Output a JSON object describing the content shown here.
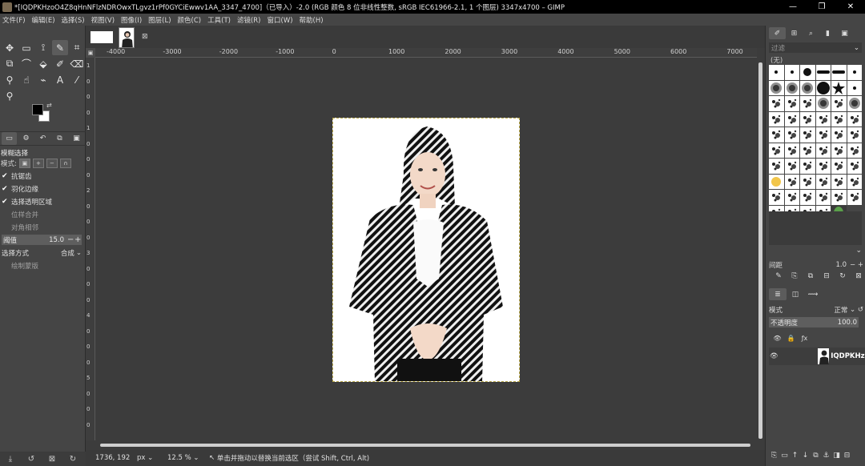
{
  "window": {
    "title": "*[IQDPKHzoO4Z8qHnNFlzNDROwxTLgvz1rPf0GYCiEwwv1AA_3347_4700]（已导入）-2.0 (RGB 颜色 8 位非线性整数, sRGB IEC61966-2.1, 1 个图层) 3347x4700 – GIMP",
    "min": "—",
    "max": "❐",
    "close": "✕"
  },
  "menu": [
    "文件(F)",
    "编辑(E)",
    "选择(S)",
    "视图(V)",
    "图像(I)",
    "图层(L)",
    "颜色(C)",
    "工具(T)",
    "滤镜(R)",
    "窗口(W)",
    "帮助(H)"
  ],
  "tool_options": {
    "title": "模糊选择",
    "mode_label": "模式:",
    "antialias": "抗锯齿",
    "feather": "羽化边缘",
    "select_transparent": "选择透明区域",
    "sample_merged": "位样合并",
    "diagonal": "对角相邻",
    "threshold_label": "阈值",
    "threshold_value": "15.0",
    "select_by_label": "选择方式",
    "select_by_value": "合成",
    "draw_mask": "绘制蒙版"
  },
  "ruler": {
    "h_ticks": [
      "-4000",
      "-3000",
      "-2000",
      "-1000",
      "0",
      "1000",
      "2000",
      "3000",
      "4000",
      "5000",
      "6000",
      "7000"
    ],
    "v_ticks": [
      "1",
      "0",
      "0",
      "0",
      "1",
      "0",
      "0",
      "0",
      "2",
      "0",
      "0",
      "0",
      "3",
      "0",
      "0",
      "0",
      "4",
      "0",
      "0",
      "0",
      "5",
      "0",
      "0",
      "0"
    ]
  },
  "status": {
    "coords": "1736, 192",
    "unit": "px",
    "zoom": "12.5 %",
    "message": "单击并拖动以替换当前选区（尝试 Shift, Ctrl, Alt)"
  },
  "brushes": {
    "filter_placeholder": "过滤",
    "current": "(无)",
    "spacing_label": "间距",
    "spacing_value": "1.0"
  },
  "layers": {
    "mode_label": "模式",
    "mode_value": "正常",
    "opacity_label": "不透明度",
    "opacity_value": "100.0",
    "layer_name": "IQDPKHzo"
  },
  "colors": {
    "accent": "#5c5c5c",
    "selection_border": "#b9a84a"
  }
}
